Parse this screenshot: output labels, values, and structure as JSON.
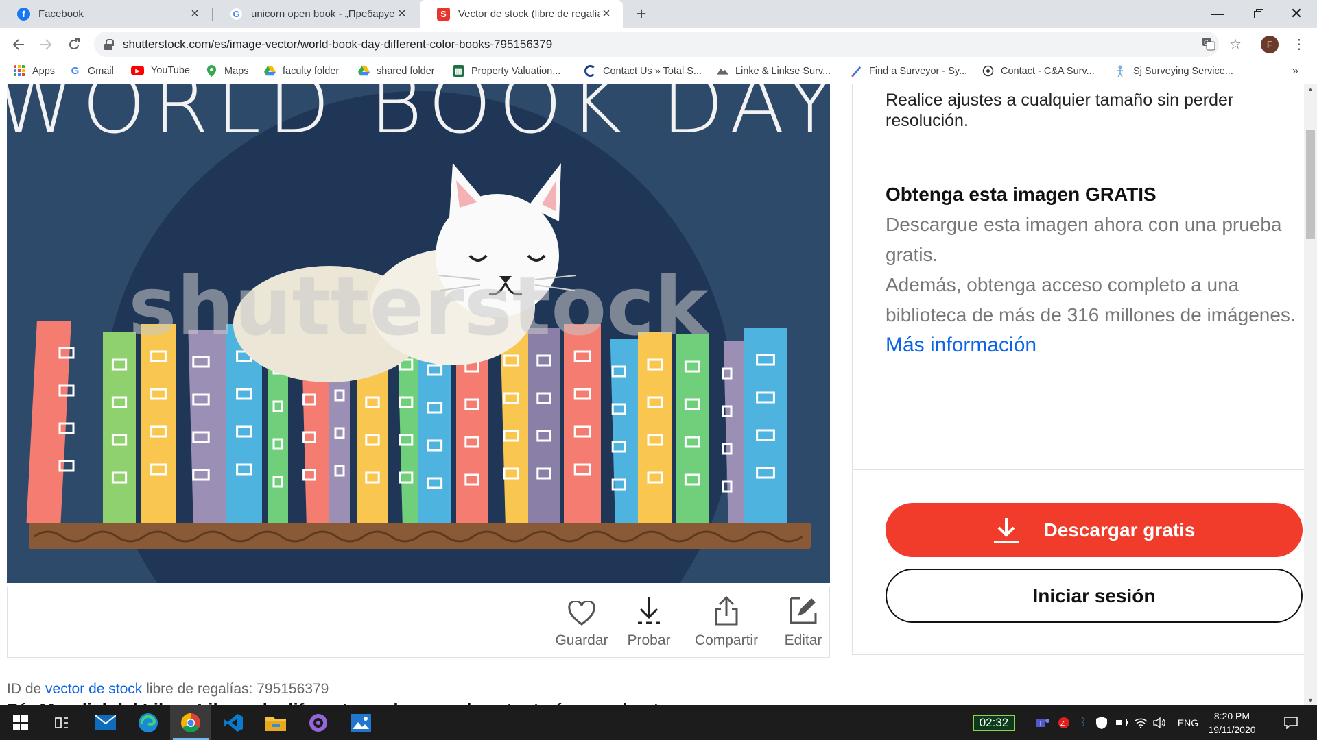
{
  "browser": {
    "tabs": [
      {
        "title": "Facebook",
        "icon": "facebook-icon",
        "color": "#1877f2"
      },
      {
        "title": "unicorn open book - „Пребаруе",
        "icon": "google-icon",
        "color": "#4285f4"
      },
      {
        "title": "Vector de stock (libre de regalías",
        "icon": "shutterstock-icon",
        "color": "#e8342a",
        "active": true
      }
    ],
    "url": "shutterstock.com/es/image-vector/world-book-day-different-color-books-795156379",
    "profile_initial": "F",
    "bookmarks": [
      {
        "label": "Apps",
        "icon": "apps-grid-icon"
      },
      {
        "label": "Gmail",
        "icon": "google-icon"
      },
      {
        "label": "YouTube",
        "icon": "youtube-icon"
      },
      {
        "label": "Maps",
        "icon": "maps-pin-icon"
      },
      {
        "label": "faculty folder",
        "icon": "google-drive-icon"
      },
      {
        "label": "shared folder",
        "icon": "google-drive-icon"
      },
      {
        "label": "Property Valuation...",
        "icon": "spreadsheet-icon"
      },
      {
        "label": "Contact Us » Total S...",
        "icon": "circle-logo-icon"
      },
      {
        "label": "Linke & Linkse Surv...",
        "icon": "mountain-logo-icon"
      },
      {
        "label": "Find a Surveyor - Sy...",
        "icon": "pen-logo-icon"
      },
      {
        "label": "Contact - C&A Surv...",
        "icon": "target-logo-icon"
      },
      {
        "label": "Sj Surveying Service...",
        "icon": "figure-logo-icon"
      }
    ]
  },
  "image": {
    "title_text": "WORLD BOOK DAY",
    "watermark": "shutterstock"
  },
  "image_actions": [
    {
      "label": "Guardar",
      "icon": "heart-icon"
    },
    {
      "label": "Probar",
      "icon": "download-icon"
    },
    {
      "label": "Compartir",
      "icon": "share-icon"
    },
    {
      "label": "Editar",
      "icon": "edit-icon"
    }
  ],
  "caption": {
    "prefix": "ID de",
    "link": "vector de stock",
    "suffix": "libre de regalías: 795156379"
  },
  "headline": "Día Mundial del Libro. Libros de diferentes colores en la estantería con el gato...",
  "panel": {
    "resize_text": "Realice ajustes a cualquier tamaño sin perder resolución.",
    "free_title": "Obtenga esta imagen GRATIS",
    "free_text": "Descargue esta imagen ahora con una prueba gratis.",
    "access_text": "Además, obtenga acceso completo a una biblioteca de más de 316 millones de imágenes.",
    "more_info": "Más información",
    "download_button": "Descargar gratis",
    "login_button": "Iniciar sesión"
  },
  "taskbar": {
    "widget_time": "02:32",
    "language": "ENG",
    "time": "8:20 PM",
    "date": "19/11/2020"
  },
  "colors": {
    "accent_red": "#f23c2b",
    "link_blue": "#0e64e6",
    "image_bg": "#2e4a6a"
  }
}
